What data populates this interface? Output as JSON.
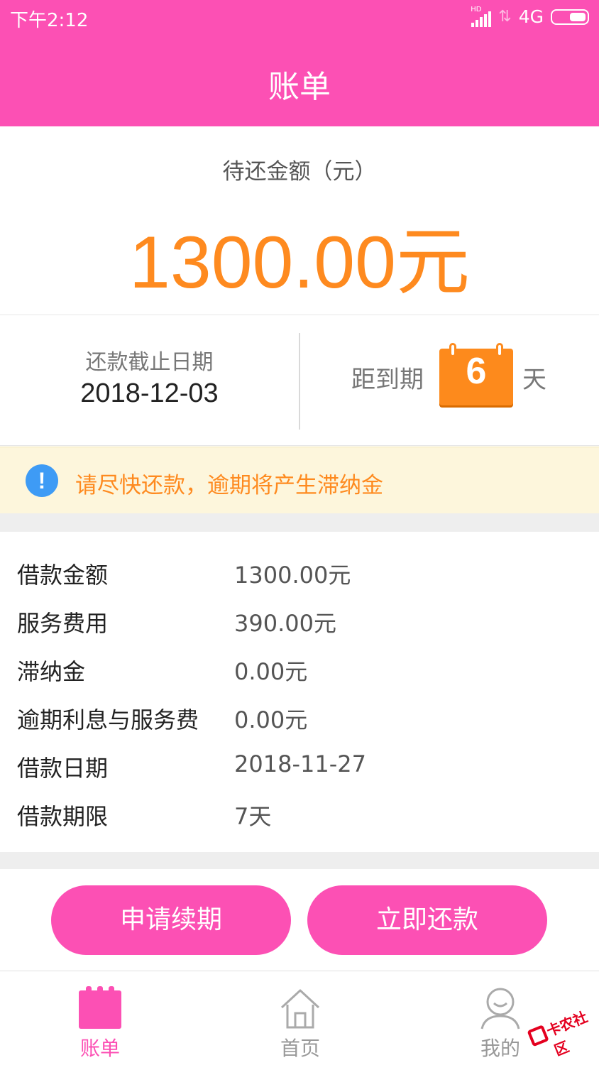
{
  "status_bar": {
    "time": "下午2:12",
    "signal_badge": "HD",
    "network": "4G",
    "icons": [
      "signal-icon",
      "data-arrows-icon",
      "battery-icon"
    ]
  },
  "header": {
    "title": "账单"
  },
  "amount": {
    "label": "待还金额（元）",
    "value": "1300.00元",
    "accent_color": "#fe8a1f"
  },
  "due": {
    "label": "还款截止日期",
    "date": "2018-12-03",
    "countdown_prefix": "距到期",
    "countdown_days": "6",
    "countdown_suffix": "天",
    "icon": "calendar-icon"
  },
  "warning": {
    "icon": "exclamation-icon",
    "text": "请尽快还款，逾期将产生滞纳金"
  },
  "details": [
    {
      "label": "借款金额",
      "value": "1300.00元"
    },
    {
      "label": "服务费用",
      "value": "390.00元"
    },
    {
      "label": "滞纳金",
      "value": "0.00元"
    },
    {
      "label": "逾期利息与服务费",
      "value": "0.00元"
    },
    {
      "label": "借款日期",
      "value": "2018-11-27"
    },
    {
      "label": "借款期限",
      "value": "7天"
    }
  ],
  "actions": {
    "renew_label": "申请续期",
    "pay_label": "立即还款"
  },
  "tabbar": {
    "items": [
      {
        "label": "账单",
        "icon": "bill-icon",
        "active": true
      },
      {
        "label": "首页",
        "icon": "home-icon",
        "active": false
      },
      {
        "label": "我的",
        "icon": "user-icon",
        "active": false
      }
    ]
  },
  "watermark": {
    "text": "卡农社区"
  },
  "colors": {
    "brand": "#fc50b4",
    "accent": "#fe8a1f",
    "warning_bg": "#fdf6dc",
    "info_icon": "#3e9bf5"
  }
}
